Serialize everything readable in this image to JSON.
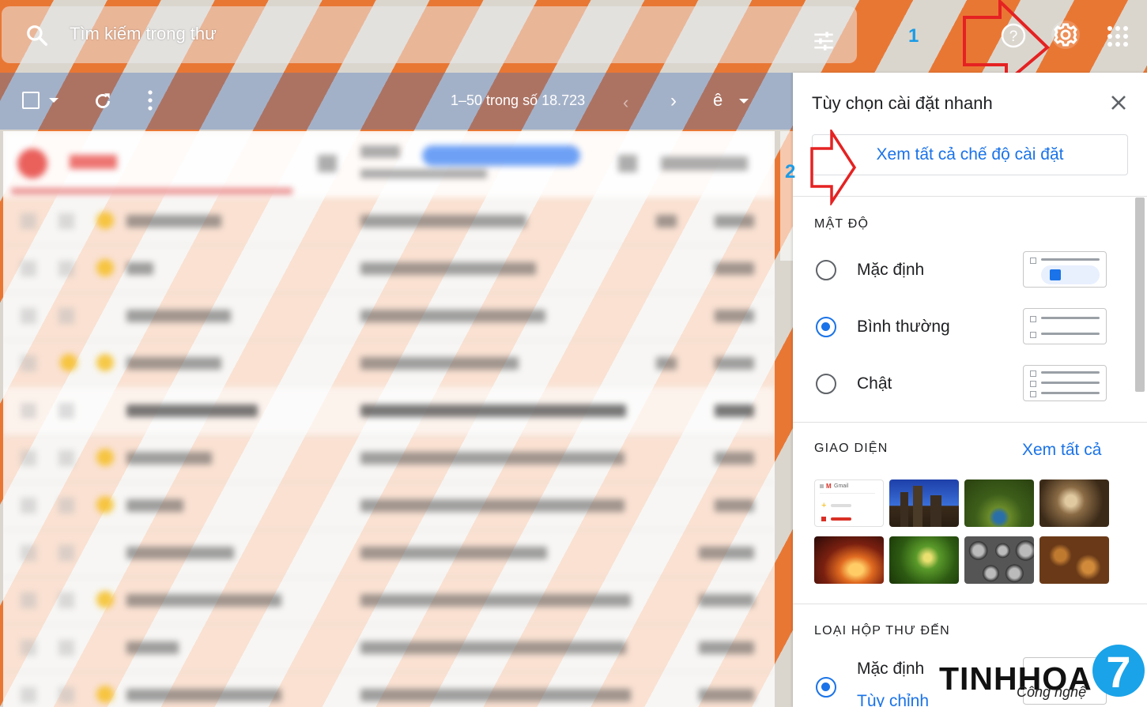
{
  "search": {
    "placeholder": "Tìm kiếm trong thư"
  },
  "annotations": {
    "step1": "1",
    "step2": "2"
  },
  "toolbar": {
    "count": "1–50 trong số 18.723",
    "prev": "‹",
    "next": "›",
    "lang_glyph": "ê"
  },
  "panel": {
    "title": "Tùy chọn cài đặt nhanh",
    "see_all_settings": "Xem tất cả chế độ cài đặt",
    "density": {
      "heading": "MẬT ĐỘ",
      "options": [
        {
          "label": "Mặc định",
          "selected": false
        },
        {
          "label": "Bình thường",
          "selected": true
        },
        {
          "label": "Chật",
          "selected": false
        }
      ]
    },
    "theme": {
      "heading": "GIAO DIỆN",
      "see_all": "Xem tất cả",
      "default_thumb_label": "Gmail"
    },
    "inbox_type": {
      "heading": "LOẠI HỘP THƯ ĐẾN",
      "options": [
        {
          "label": "Mặc định",
          "selected": true
        },
        {
          "label": "Tùy chỉnh",
          "link": true
        }
      ]
    }
  },
  "watermark": {
    "brand": "TINHHOA",
    "tagline": "Công nghệ",
    "badge": "7"
  },
  "colors": {
    "accent": "#1a73e8",
    "arrow": "#e52222",
    "annotation": "#1a9be6"
  }
}
